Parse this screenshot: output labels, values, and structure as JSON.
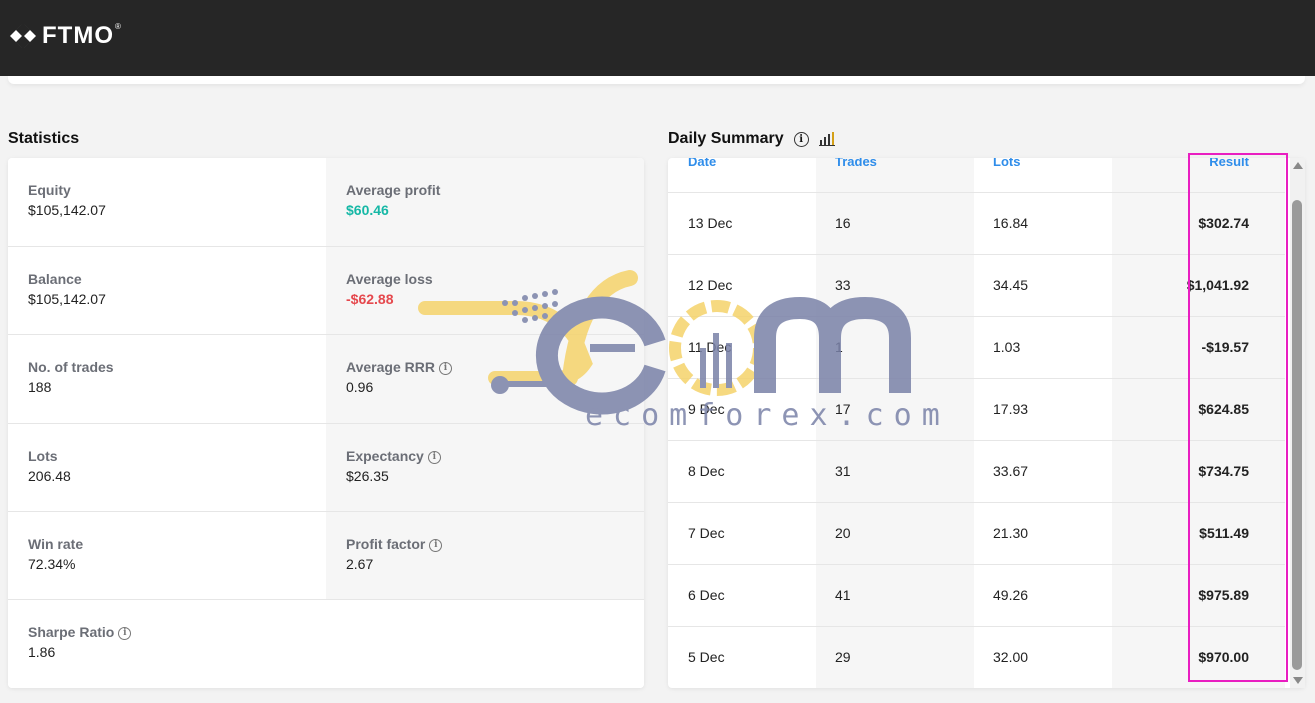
{
  "brand": {
    "name": "FTMO",
    "reg": "®"
  },
  "statistics": {
    "title": "Statistics",
    "rows": [
      {
        "left": {
          "label": "Equity",
          "value": "$105,142.07"
        },
        "right": {
          "label": "Average profit",
          "value": "$60.46"
        }
      },
      {
        "left": {
          "label": "Balance",
          "value": "$105,142.07"
        },
        "right": {
          "label": "Average loss",
          "value": "-$62.88"
        }
      },
      {
        "left": {
          "label": "No. of trades",
          "value": "188"
        },
        "right": {
          "label": "Average RRR",
          "value": "0.96"
        }
      },
      {
        "left": {
          "label": "Lots",
          "value": "206.48"
        },
        "right": {
          "label": "Expectancy",
          "value": "$26.35"
        }
      },
      {
        "left": {
          "label": "Win rate",
          "value": "72.34%"
        },
        "right": {
          "label": "Profit factor",
          "value": "2.67"
        }
      },
      {
        "left": {
          "label": "Sharpe Ratio",
          "value": "1.86"
        }
      }
    ]
  },
  "daily_summary": {
    "title": "Daily Summary",
    "columns": [
      "Date",
      "Trades",
      "Lots",
      "Result"
    ],
    "rows": [
      {
        "date": "13 Dec",
        "trades": "16",
        "lots": "16.84",
        "result": "$302.74"
      },
      {
        "date": "12 Dec",
        "trades": "33",
        "lots": "34.45",
        "result": "$1,041.92"
      },
      {
        "date": "11 Dec",
        "trades": "1",
        "lots": "1.03",
        "result": "-$19.57"
      },
      {
        "date": "9 Dec",
        "trades": "17",
        "lots": "17.93",
        "result": "$624.85"
      },
      {
        "date": "8 Dec",
        "trades": "31",
        "lots": "33.67",
        "result": "$734.75"
      },
      {
        "date": "7 Dec",
        "trades": "20",
        "lots": "21.30",
        "result": "$511.49"
      },
      {
        "date": "6 Dec",
        "trades": "41",
        "lots": "49.26",
        "result": "$975.89"
      },
      {
        "date": "5 Dec",
        "trades": "29",
        "lots": "32.00",
        "result": "$970.00"
      }
    ]
  },
  "watermark": {
    "text": "ecomforex.com"
  },
  "colors": {
    "positive": "#16b8a6",
    "negative": "#e5484d",
    "header_link": "#2f8dea",
    "highlight": "#e91ec1"
  }
}
